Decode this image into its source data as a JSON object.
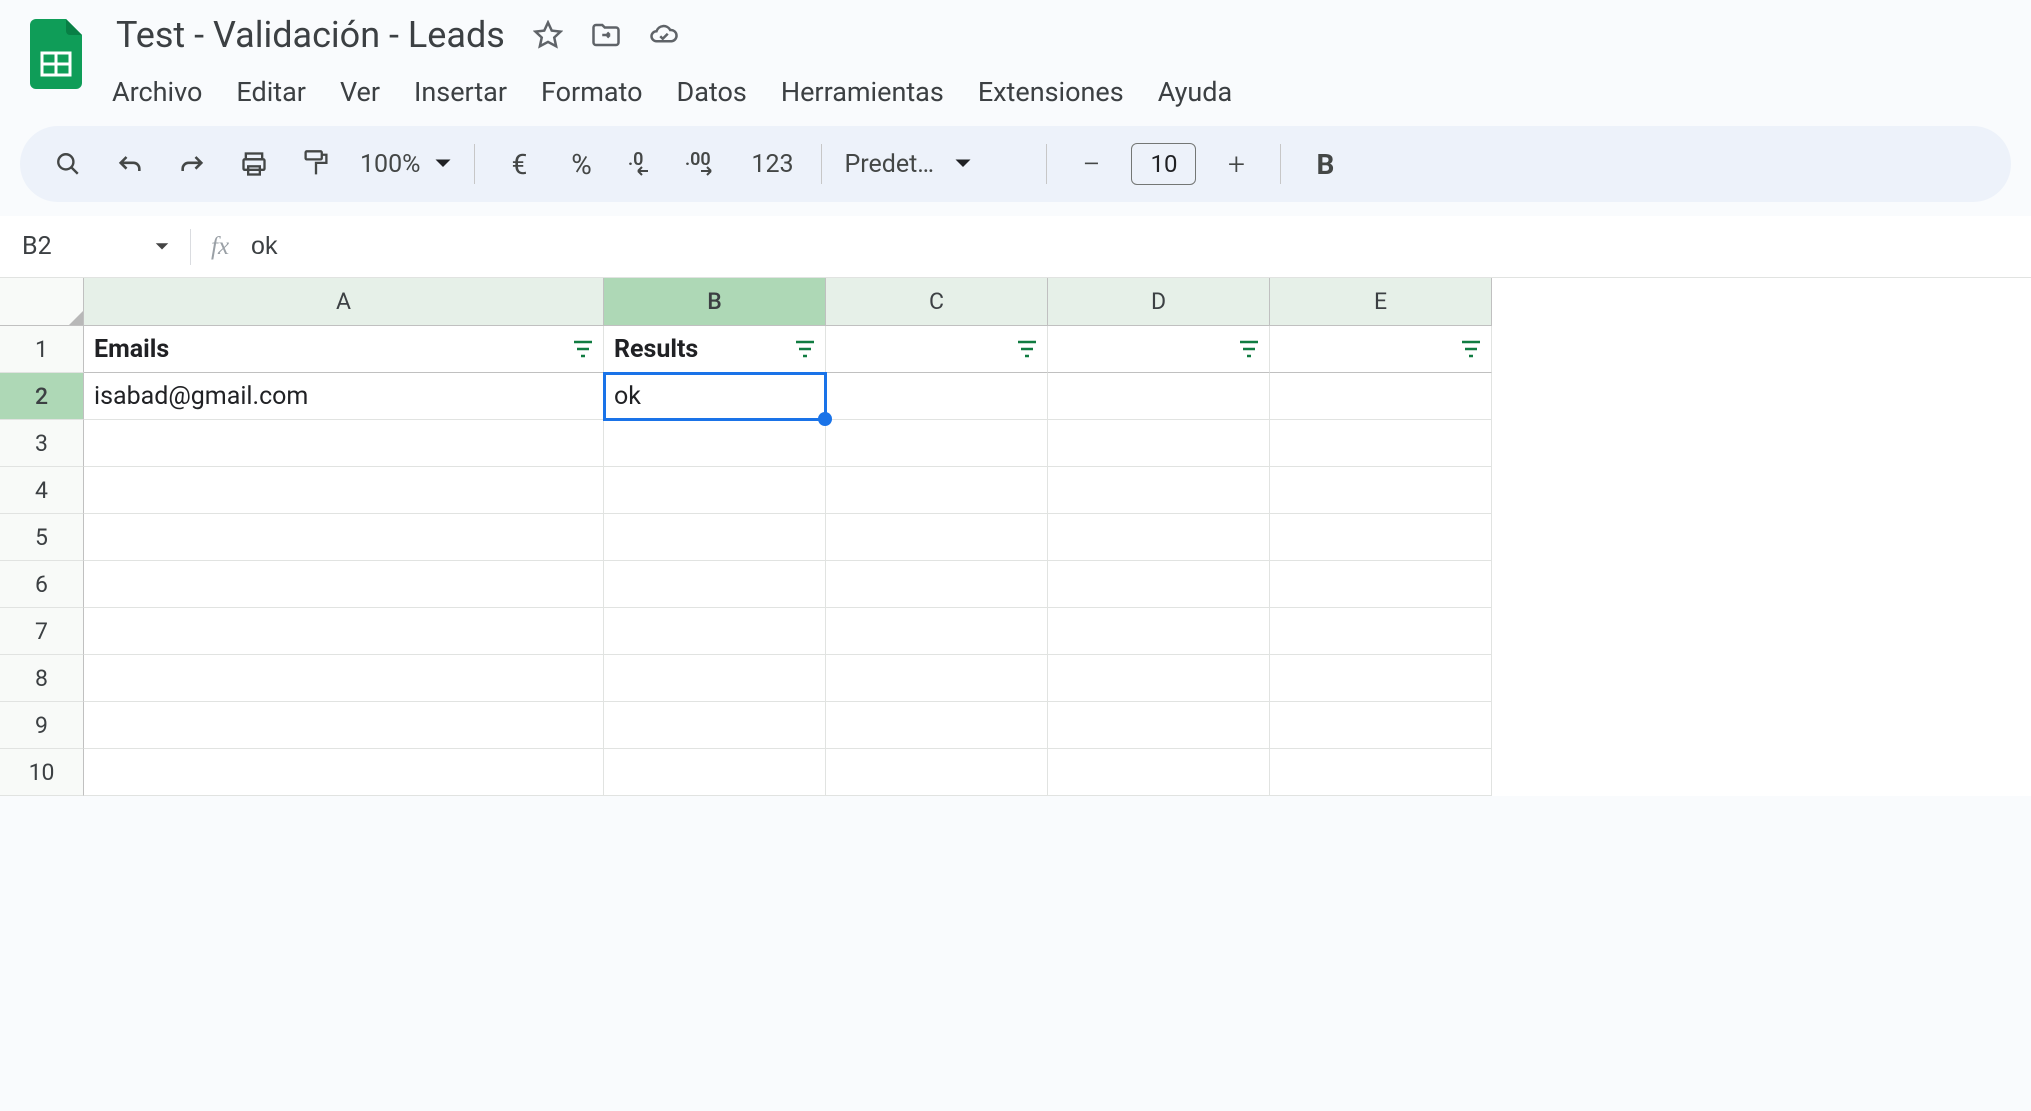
{
  "header": {
    "doc_title": "Test - Validación - Leads"
  },
  "menubar": {
    "items": [
      "Archivo",
      "Editar",
      "Ver",
      "Insertar",
      "Formato",
      "Datos",
      "Herramientas",
      "Extensiones",
      "Ayuda"
    ]
  },
  "toolbar": {
    "zoom": "100%",
    "currency": "€",
    "percent": "%",
    "dec_decrease": ".0",
    "dec_increase": ".00",
    "number_format": "123",
    "font_name": "Predet…",
    "font_size": "10",
    "bold": "B"
  },
  "namebox": {
    "cell_ref": "B2",
    "fx": "fx",
    "formula": "ok"
  },
  "columns": [
    "A",
    "B",
    "C",
    "D",
    "E"
  ],
  "rows": [
    "1",
    "2",
    "3",
    "4",
    "5",
    "6",
    "7",
    "8",
    "9",
    "10"
  ],
  "active_col": "B",
  "active_row": "2",
  "cells": {
    "A1": "Emails",
    "B1": "Results",
    "A2": "isabad@gmail.com",
    "B2": "ok"
  }
}
